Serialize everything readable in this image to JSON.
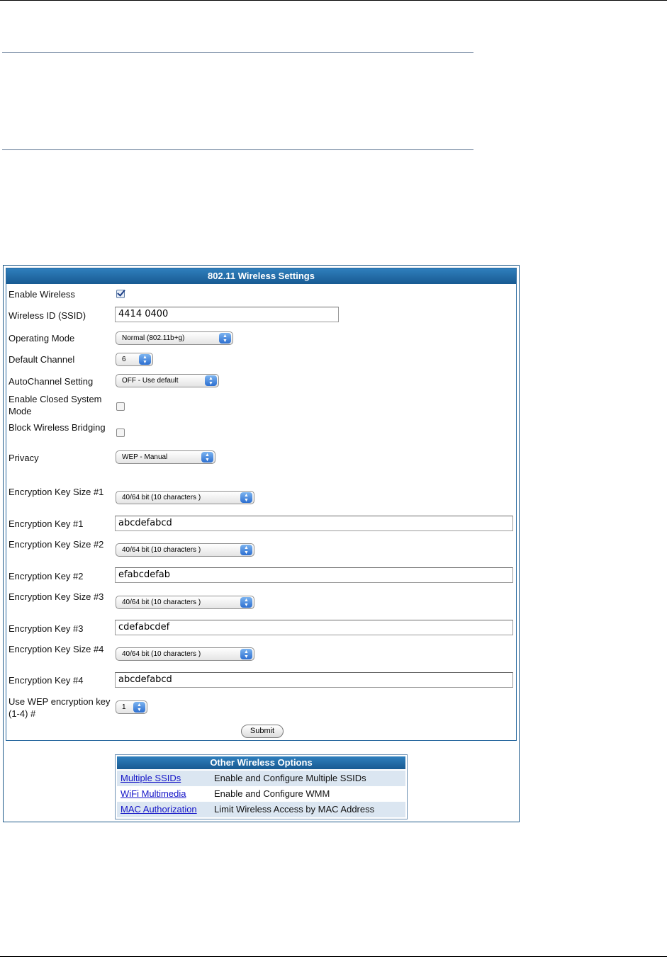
{
  "settings": {
    "title": "802.11 Wireless Settings",
    "enable_wireless": {
      "label": "Enable Wireless",
      "checked": true
    },
    "ssid": {
      "label": "Wireless ID (SSID)",
      "value": "4414 0400"
    },
    "operating_mode": {
      "label": "Operating Mode",
      "value": "Normal (802.11b+g)"
    },
    "default_channel": {
      "label": "Default Channel",
      "value": "6"
    },
    "autochannel": {
      "label": "AutoChannel Setting",
      "value": "OFF - Use default"
    },
    "closed_system": {
      "label": "Enable Closed System Mode",
      "checked": false
    },
    "block_bridging": {
      "label": "Block Wireless Bridging",
      "checked": false
    },
    "privacy": {
      "label": "Privacy",
      "value": "WEP - Manual"
    },
    "keys": [
      {
        "size_label": "Encryption Key Size #1",
        "size_value": "40/64 bit (10 characters )",
        "key_label": "Encryption Key #1",
        "key_value": "abcdefabcd"
      },
      {
        "size_label": "Encryption Key Size #2",
        "size_value": "40/64 bit (10 characters )",
        "key_label": "Encryption Key #2",
        "key_value": "efabcdefab"
      },
      {
        "size_label": "Encryption Key Size #3",
        "size_value": "40/64 bit (10 characters )",
        "key_label": "Encryption Key #3",
        "key_value": "cdefabcdef"
      },
      {
        "size_label": "Encryption Key Size #4",
        "size_value": "40/64 bit (10 characters )",
        "key_label": "Encryption Key #4",
        "key_value": "abcdefabcd"
      }
    ],
    "wep_key_index": {
      "label": "Use WEP encryption key (1-4) #",
      "value": "1"
    },
    "submit_label": "Submit"
  },
  "other_options": {
    "title": "Other Wireless Options",
    "rows": [
      {
        "link": "Multiple SSIDs",
        "desc": "Enable and Configure Multiple SSIDs"
      },
      {
        "link": "WiFi Multimedia",
        "desc": "Enable and Configure WMM"
      },
      {
        "link": "MAC Authorization",
        "desc": "Limit Wireless Access by MAC Address"
      }
    ]
  },
  "icons": {
    "select_arrows": "up-down-arrows-icon",
    "checkmark": "checkmark-icon"
  },
  "colors": {
    "title_bar": "#185a92",
    "link": "#1515c8",
    "row_shade": "#dbe6f1"
  }
}
